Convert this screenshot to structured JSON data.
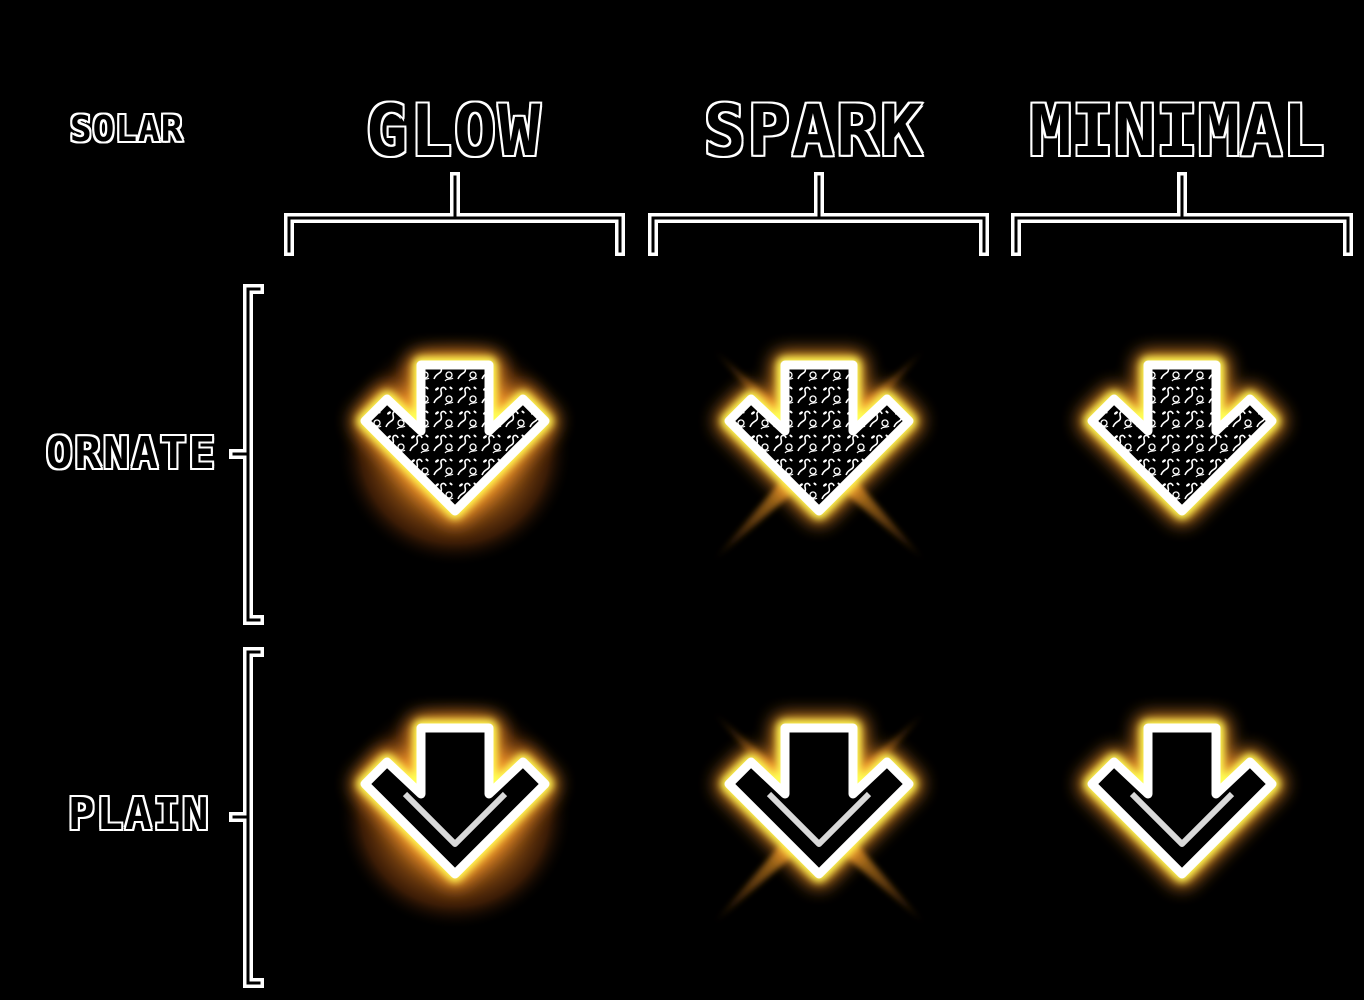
{
  "corner_label": "SOLAR",
  "columns": [
    {
      "key": "glow",
      "label": "GLOW"
    },
    {
      "key": "spark",
      "label": "SPARK"
    },
    {
      "key": "minimal",
      "label": "MINIMAL"
    }
  ],
  "rows": [
    {
      "key": "ornate",
      "label": "ORNATE"
    },
    {
      "key": "plain",
      "label": "PLAIN"
    }
  ],
  "cells": [
    {
      "row": "ornate",
      "column": "glow",
      "icon": "down-arrow-icon",
      "effect": "glow",
      "pattern": "ornate"
    },
    {
      "row": "ornate",
      "column": "spark",
      "icon": "down-arrow-icon",
      "effect": "spark",
      "pattern": "ornate"
    },
    {
      "row": "ornate",
      "column": "minimal",
      "icon": "down-arrow-icon",
      "effect": "minimal",
      "pattern": "ornate"
    },
    {
      "row": "plain",
      "column": "glow",
      "icon": "down-arrow-icon",
      "effect": "glow",
      "pattern": "plain"
    },
    {
      "row": "plain",
      "column": "spark",
      "icon": "down-arrow-icon",
      "effect": "spark",
      "pattern": "plain"
    },
    {
      "row": "plain",
      "column": "minimal",
      "icon": "down-arrow-icon",
      "effect": "minimal",
      "pattern": "plain"
    }
  ],
  "colors": {
    "background": "#000000",
    "label": "#ffffff",
    "arrow_core": "#ffffff",
    "glow_inner": "#ffff66",
    "glow_outer": "#ff9933",
    "spark": "#ffaa33"
  }
}
